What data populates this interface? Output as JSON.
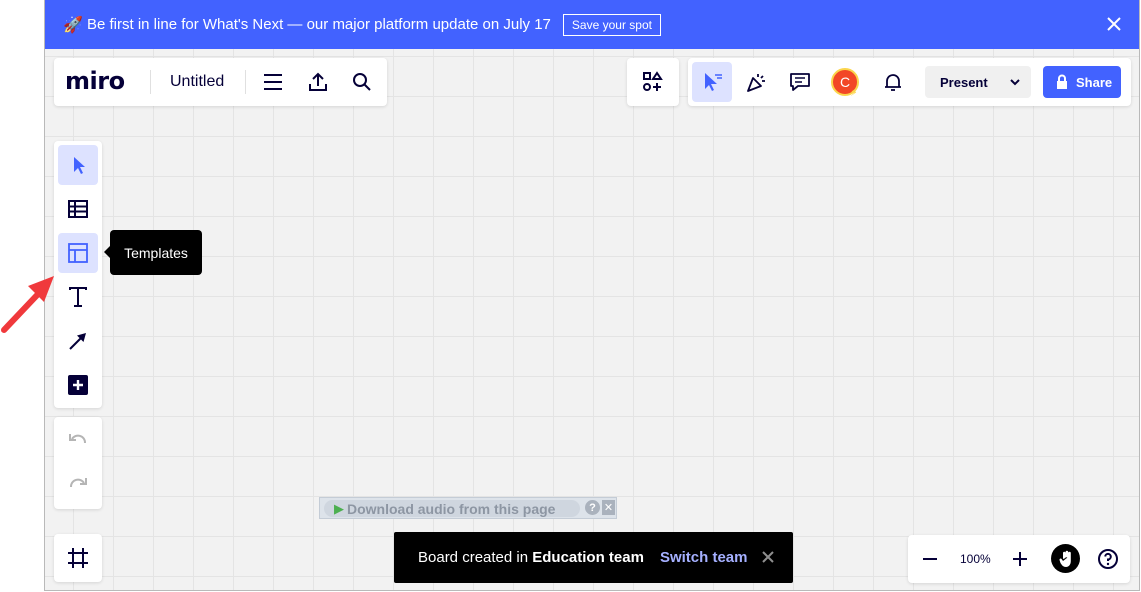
{
  "banner": {
    "rocket": "🚀",
    "text": "Be first in line for What's Next — our major platform update on July 17",
    "cta_label": "Save your spot",
    "close_icon": "close-icon"
  },
  "header": {
    "logo": "miro",
    "board_title": "Untitled",
    "present_label": "Present",
    "share_label": "Share",
    "avatar_initial": "C"
  },
  "toolbar": {
    "tooltip": "Templates"
  },
  "toast": {
    "prefix": "Board created in ",
    "team": "Education team",
    "action": "Switch team"
  },
  "zoom": {
    "level": "100%"
  },
  "audio_helper": {
    "label": "Download audio from this page"
  },
  "colors": {
    "accent": "#4262ff",
    "avatar": "#f24726",
    "arrow": "#f0393c"
  }
}
